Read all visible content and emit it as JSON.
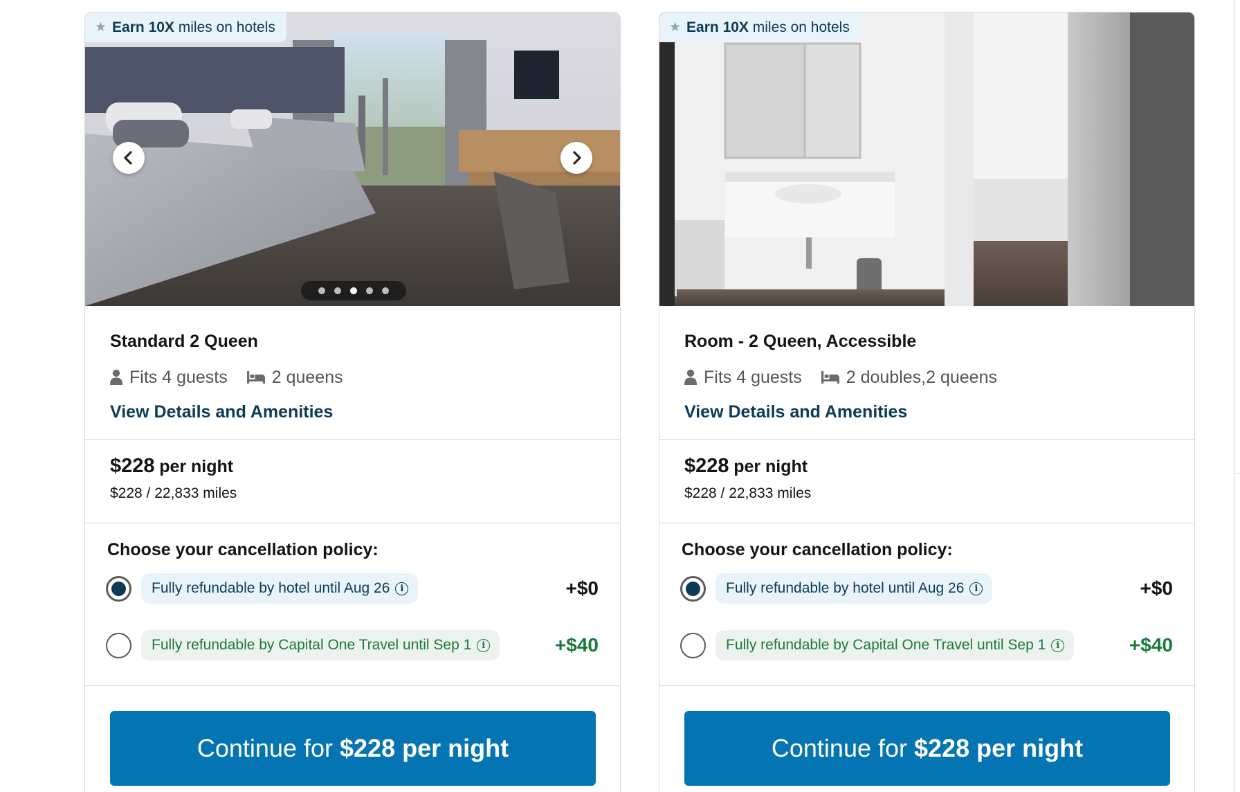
{
  "rooms": [
    {
      "badge": {
        "prefix": "Earn",
        "highlight": "10X",
        "suffix": "miles on hotels"
      },
      "carousel": {
        "dots": 5,
        "active": 3
      },
      "name": "Standard 2 Queen",
      "guests": "Fits 4 guests",
      "beds": "2 queens",
      "details_link": "View Details and Amenities",
      "price": {
        "amount": "$228",
        "unit": "per night",
        "alt": "$228 / 22,833 miles"
      },
      "policy_title": "Choose your cancellation policy:",
      "options": [
        {
          "label": "Fully refundable by hotel until Aug 26",
          "price": "+$0",
          "selected": true
        },
        {
          "label": "Fully refundable by Capital One Travel until Sep 1",
          "price": "+$40",
          "selected": false
        }
      ],
      "cta": {
        "prefix": "Continue for",
        "bold": "$228 per night"
      }
    },
    {
      "badge": {
        "prefix": "Earn",
        "highlight": "10X",
        "suffix": "miles on hotels"
      },
      "name": "Room - 2 Queen, Accessible",
      "guests": "Fits 4 guests",
      "beds": "2 doubles,2 queens",
      "details_link": "View Details and Amenities",
      "price": {
        "amount": "$228",
        "unit": "per night",
        "alt": "$228 / 22,833 miles"
      },
      "policy_title": "Choose your cancellation policy:",
      "options": [
        {
          "label": "Fully refundable by hotel until Aug 26",
          "price": "+$0",
          "selected": true
        },
        {
          "label": "Fully refundable by Capital One Travel until Sep 1",
          "price": "+$40",
          "selected": false
        }
      ],
      "cta": {
        "prefix": "Continue for",
        "bold": "$228 per night"
      }
    }
  ],
  "colors": {
    "brand_blue": "#0574b2",
    "navy": "#0d3b55",
    "green": "#1a7a3a",
    "badge_bg": "#e9f4fa"
  },
  "icons": [
    "star-icon",
    "person-icon",
    "bed-icon",
    "info-icon",
    "chevron-left-icon",
    "chevron-right-icon"
  ]
}
